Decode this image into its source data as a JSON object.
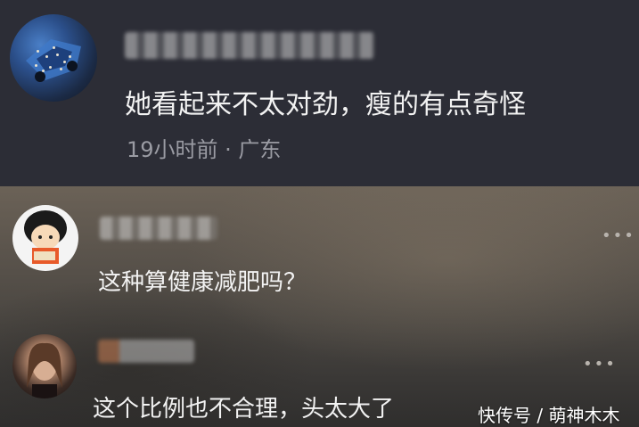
{
  "comments": [
    {
      "text": "她看起来不太对劲，瘦的有点奇怪",
      "time": "19小时前",
      "separator": "·",
      "location": "广东",
      "meta": "19小时前 · 广东"
    },
    {
      "text": "这种算健康减肥吗？"
    },
    {
      "text": "这个比例也不合理，头太大了"
    }
  ],
  "more_glyph": "•••",
  "watermark": "快传号 / 萌神木木",
  "colors": {
    "top_panel": "#2c2d36",
    "comment_text": "#f2f2f2",
    "meta_text": "#9a9ba3"
  }
}
